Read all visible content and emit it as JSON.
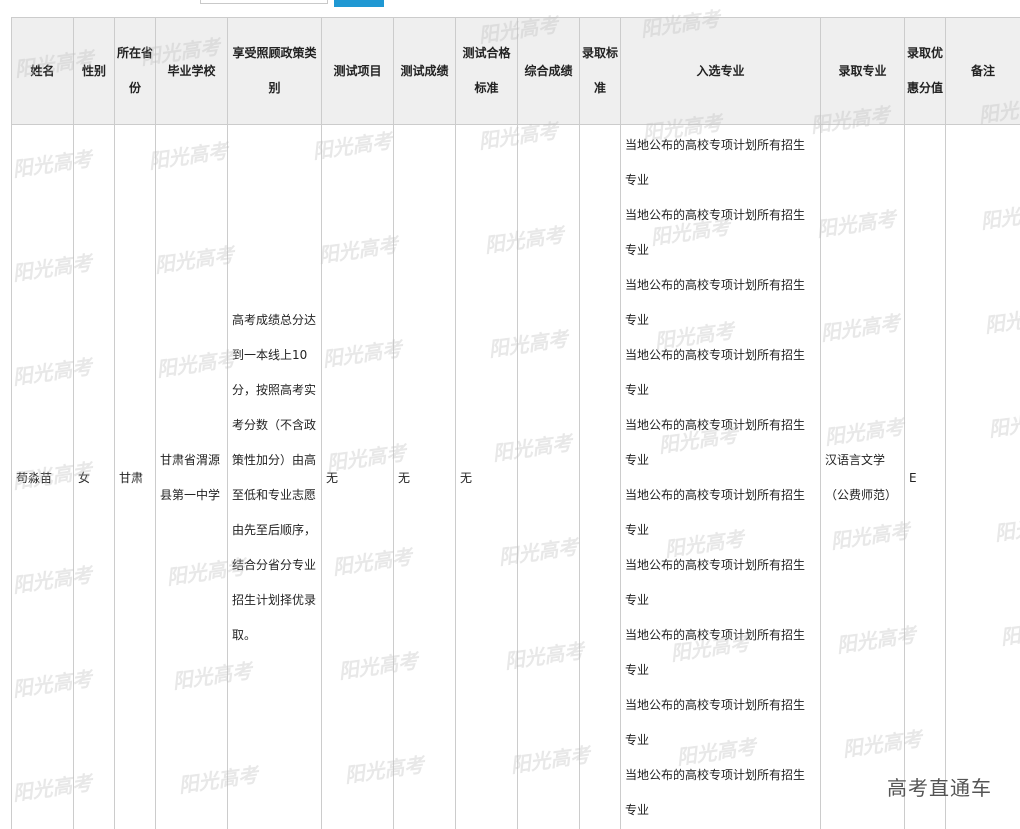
{
  "toolbar": {
    "search_value": "",
    "search_button_label": ""
  },
  "table": {
    "headers": {
      "name": "姓名",
      "gender": "性别",
      "province": "所在省份",
      "school": "毕业学校",
      "policy_type": "享受照顾政策类别",
      "test_item": "测试项目",
      "test_score": "测试成绩",
      "test_standard": "测试合格标准",
      "composite_score": "综合成绩",
      "admit_standard": "录取标准",
      "selected_major": "入选专业",
      "admitted_major": "录取专业",
      "bonus": "录取优惠分值",
      "remarks": "备注"
    },
    "row": {
      "name": "苟淼苗",
      "gender": "女",
      "province": "甘肃",
      "school": "甘肃省渭源县第一中学",
      "policy_type": "高考成绩总分达到一本线上10分，按照高考实考分数（不含政策性加分）由高至低和专业志愿由先至后顺序，结合分省分专业招生计划择优录取。",
      "test_item": "无",
      "test_score": "无",
      "test_standard": "无",
      "composite_score": "",
      "admit_standard": "",
      "selected_majors": [
        "当地公布的高校专项计划所有招生专业",
        "当地公布的高校专项计划所有招生专业",
        "当地公布的高校专项计划所有招生专业",
        "当地公布的高校专项计划所有招生专业",
        "当地公布的高校专项计划所有招生专业",
        "当地公布的高校专项计划所有招生专业",
        "当地公布的高校专项计划所有招生专业",
        "当地公布的高校专项计划所有招生专业",
        "当地公布的高校专项计划所有招生专业",
        "当地公布的高校专项计划所有招生专业"
      ],
      "admitted_major": "汉语言文学（公费师范）",
      "bonus": "E",
      "remarks": ""
    }
  },
  "watermark": {
    "text": "阳光高考"
  },
  "corner_logo": {
    "text": "高考直通车"
  },
  "colors": {
    "header_bg": "#efefef",
    "border": "#cccccc",
    "search_button": "#1f98d3"
  }
}
